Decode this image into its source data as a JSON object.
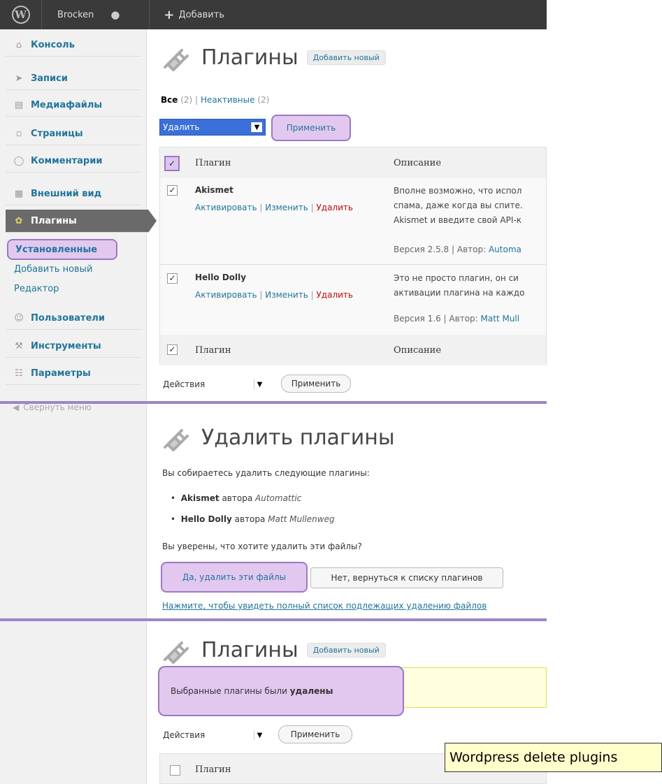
{
  "adminbar": {
    "site_name": "Brocken",
    "add_label": "Добавить"
  },
  "sidebar": {
    "items": [
      {
        "label": "Консоль",
        "icon": "home-icon"
      },
      {
        "label": "Записи",
        "icon": "pin-icon"
      },
      {
        "label": "Медиафайлы",
        "icon": "media-icon"
      },
      {
        "label": "Страницы",
        "icon": "pages-icon"
      },
      {
        "label": "Комментарии",
        "icon": "comments-icon"
      },
      {
        "label": "Внешний вид",
        "icon": "appearance-icon"
      },
      {
        "label": "Плагины",
        "icon": "plugin-icon"
      },
      {
        "label": "Пользователи",
        "icon": "users-icon"
      },
      {
        "label": "Инструменты",
        "icon": "tools-icon"
      },
      {
        "label": "Параметры",
        "icon": "settings-icon"
      }
    ],
    "submenu": [
      "Установленные",
      "Добавить новый",
      "Редактор"
    ],
    "collapse": "Свернуть меню"
  },
  "section1": {
    "title": "Плагины",
    "add_new": "Добавить новый",
    "filter_all": "Все",
    "filter_all_count": "(2)",
    "filter_sep": "|",
    "filter_inactive": "Неактивные",
    "filter_inactive_count": "(2)",
    "bulk_select": "Удалить",
    "apply": "Применить",
    "col_plugin": "Плагин",
    "col_desc": "Описание",
    "bottom_select": "Действия",
    "bottom_apply": "Применить",
    "plugins": [
      {
        "name": "Akismet",
        "activate": "Активировать",
        "edit": "Изменить",
        "delete": "Удалить",
        "desc_lines": [
          "Вполне возможно, что испол",
          "спама, даже когда вы спите.",
          "Akismet и введите свой API-к"
        ],
        "version": "Версия 2.5.8 | Автор:",
        "author": "Automa"
      },
      {
        "name": "Hello Dolly",
        "activate": "Активировать",
        "edit": "Изменить",
        "delete": "Удалить",
        "desc_lines": [
          "Это не просто плагин, он си",
          "активации плагина на каждо"
        ],
        "version": "Версия 1.6 | Автор:",
        "author": "Matt Mull"
      }
    ]
  },
  "section2": {
    "title": "Удалить плагины",
    "intro": "Вы собираетесь удалить следующие плагины:",
    "items": [
      {
        "name": "Akismet",
        "by": "автора",
        "author": "Automattic"
      },
      {
        "name": "Hello Dolly",
        "by": "автора",
        "author": "Matt Mullenweg"
      }
    ],
    "question": "Вы уверены, что хотите удалить эти файлы?",
    "yes_button": "Да, удалить эти файлы",
    "no_button": "Нет, вернуться к списку плагинов",
    "files_link": "Нажмите, чтобы увидеть полный список подлежащих удалению файлов"
  },
  "section3": {
    "title": "Плагины",
    "add_new": "Добавить новый",
    "notice_text": "Выбранные плагины были",
    "notice_bold": "удалены",
    "select": "Действия",
    "apply": "Применить",
    "col_plugin": "Плагин"
  },
  "caption": "Wordpress delete plugins"
}
